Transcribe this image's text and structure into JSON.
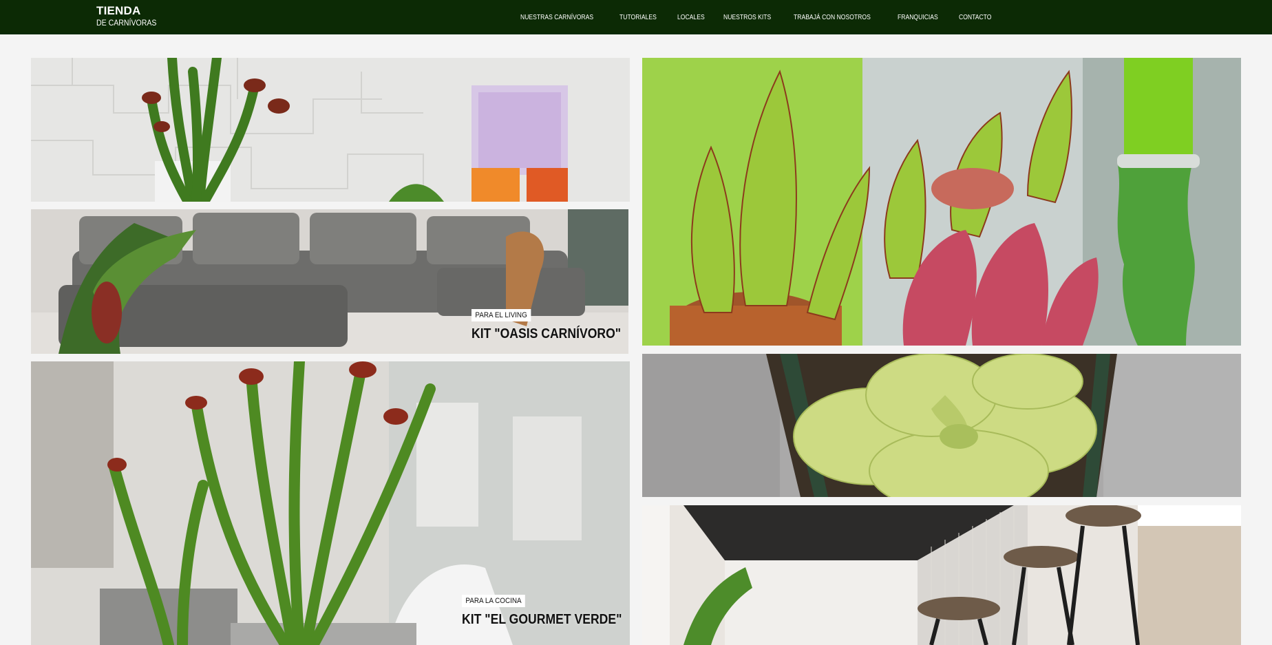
{
  "brand": {
    "main": "TIENDA",
    "sub": "DE CARNÍVORAS"
  },
  "nav": {
    "items": [
      "NUESTRAS CARNÍVORAS",
      "TUTORIALES",
      "LOCALES",
      "NUESTROS KITS",
      "TRABAJÁ CON NOSOTROS",
      "FRANQUICIAS",
      "CONTACTO"
    ]
  },
  "colors": {
    "header_bg": "#0c2a05",
    "page_bg": "#f4f4f4"
  },
  "cards": [
    {
      "name": "card-pitcher-white-wall",
      "tag": "",
      "title": ""
    },
    {
      "name": "card-living-sofa",
      "tag": "PARA EL LIVING",
      "title": "KIT \"OASIS CARNÍVORO\""
    },
    {
      "name": "card-kitchen-pitcher",
      "tag": "PARA LA COCINA",
      "title": "KIT \"EL GOURMET VERDE\""
    },
    {
      "name": "card-pitcher-closeup",
      "tag": "",
      "title": ""
    },
    {
      "name": "card-butterwort",
      "tag": "",
      "title": ""
    },
    {
      "name": "card-kitchen-island",
      "tag": "",
      "title": ""
    }
  ]
}
